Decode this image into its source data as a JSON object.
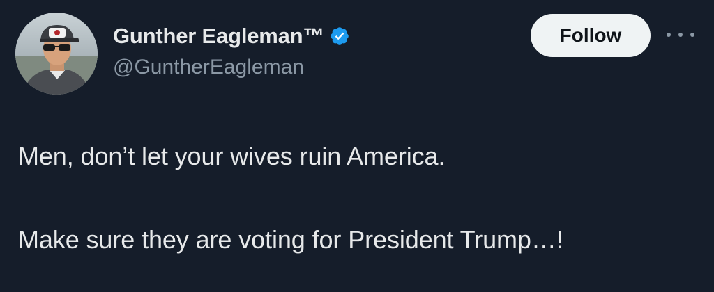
{
  "author": {
    "display_name": "Gunther Eagleman™",
    "handle": "@GuntherEagleman",
    "verified": true,
    "verified_color": "#1d9bf0"
  },
  "actions": {
    "follow_label": "Follow",
    "more_icon": "more-horizontal-icon"
  },
  "tweet": {
    "lines": [
      "Men, don’t let your wives ruin America.",
      "Make sure they are voting for President Trump…!"
    ]
  },
  "colors": {
    "background": "#151d2a",
    "text_primary": "#e7e9ea",
    "text_secondary": "#8b98a5",
    "follow_button_bg": "#eff3f4"
  }
}
